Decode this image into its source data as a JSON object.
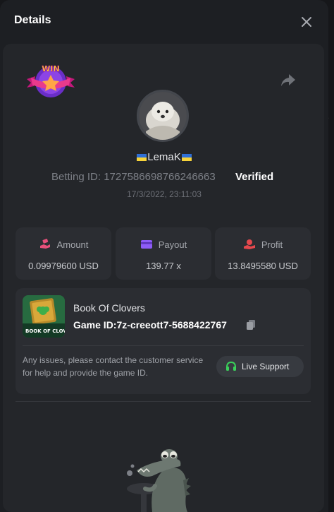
{
  "header": {
    "title": "Details"
  },
  "player": {
    "username": "LemaK",
    "betting_id_label": "Betting ID: 1727586698766246663",
    "verified_label": "Verified",
    "timestamp": "17/3/2022, 23:11:03"
  },
  "stats": [
    {
      "label": "Amount",
      "value": "0.09979600 USD",
      "icon": "hand-coin-icon",
      "color": "#e7507a"
    },
    {
      "label": "Payout",
      "value": "139.77 x",
      "icon": "card-icon",
      "color": "#8d5cf6"
    },
    {
      "label": "Profit",
      "value": "13.8495580 USD",
      "icon": "hand-money-icon",
      "color": "#e5484d"
    }
  ],
  "game": {
    "name": "Book Of Clovers",
    "game_id": "Game ID:7z-creeott7-5688422767",
    "thumbnail_caption": "BOOK OF CLOVERS"
  },
  "support": {
    "notice": "Any issues, please contact the customer service for help and provide the game ID.",
    "button_label": "Live Support",
    "icon_color": "#3ad05a"
  },
  "badge": {
    "text": "WIN"
  },
  "colors": {
    "modal_bg": "#1d1f23",
    "panel_bg": "#24262a",
    "card_bg": "#2b2d32",
    "accent_green": "#3ad05a"
  }
}
